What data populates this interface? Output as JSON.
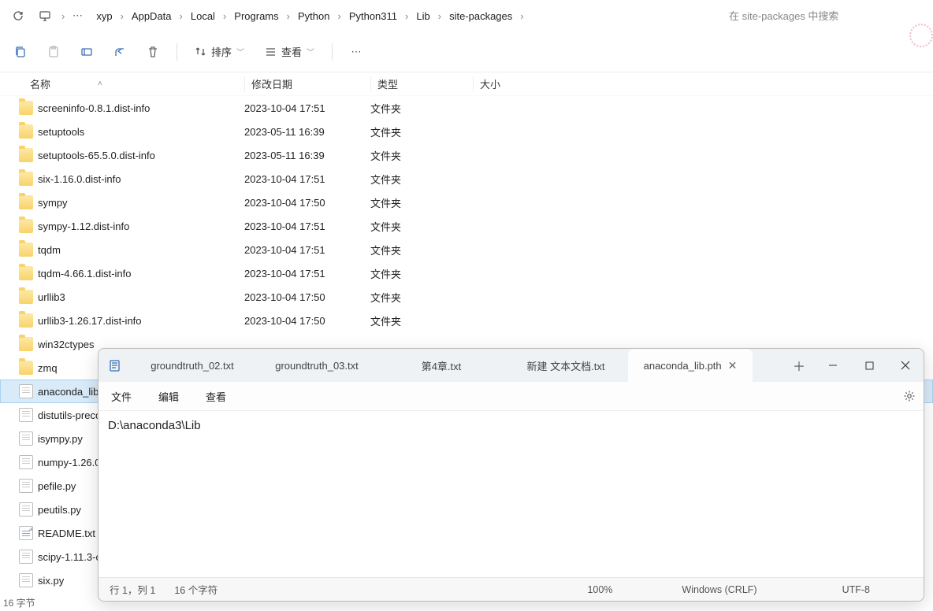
{
  "breadcrumb": {
    "items": [
      "xyp",
      "AppData",
      "Local",
      "Programs",
      "Python",
      "Python311",
      "Lib",
      "site-packages"
    ],
    "search_placeholder": "在 site-packages 中搜索"
  },
  "toolbar": {
    "sort_label": "排序",
    "view_label": "查看"
  },
  "columns": {
    "name": "名称",
    "date": "修改日期",
    "type": "类型",
    "size": "大小"
  },
  "folder_type": "文件夹",
  "files": [
    {
      "icon": "folder",
      "name": "screeninfo-0.8.1.dist-info",
      "date": "2023-10-04 17:51",
      "type": "文件夹"
    },
    {
      "icon": "folder",
      "name": "setuptools",
      "date": "2023-05-11 16:39",
      "type": "文件夹"
    },
    {
      "icon": "folder",
      "name": "setuptools-65.5.0.dist-info",
      "date": "2023-05-11 16:39",
      "type": "文件夹"
    },
    {
      "icon": "folder",
      "name": "six-1.16.0.dist-info",
      "date": "2023-10-04 17:51",
      "type": "文件夹"
    },
    {
      "icon": "folder",
      "name": "sympy",
      "date": "2023-10-04 17:50",
      "type": "文件夹"
    },
    {
      "icon": "folder",
      "name": "sympy-1.12.dist-info",
      "date": "2023-10-04 17:51",
      "type": "文件夹"
    },
    {
      "icon": "folder",
      "name": "tqdm",
      "date": "2023-10-04 17:51",
      "type": "文件夹"
    },
    {
      "icon": "folder",
      "name": "tqdm-4.66.1.dist-info",
      "date": "2023-10-04 17:51",
      "type": "文件夹"
    },
    {
      "icon": "folder",
      "name": "urllib3",
      "date": "2023-10-04 17:50",
      "type": "文件夹"
    },
    {
      "icon": "folder",
      "name": "urllib3-1.26.17.dist-info",
      "date": "2023-10-04 17:50",
      "type": "文件夹"
    },
    {
      "icon": "folder",
      "name": "win32ctypes",
      "date": "",
      "type": ""
    },
    {
      "icon": "folder",
      "name": "zmq",
      "date": "",
      "type": ""
    },
    {
      "icon": "file",
      "name": "anaconda_lib.",
      "date": "",
      "type": "",
      "selected": true
    },
    {
      "icon": "file",
      "name": "distutils-preco",
      "date": "",
      "type": ""
    },
    {
      "icon": "file",
      "name": "isympy.py",
      "date": "",
      "type": ""
    },
    {
      "icon": "file",
      "name": "numpy-1.26.0",
      "date": "",
      "type": ""
    },
    {
      "icon": "file",
      "name": "pefile.py",
      "date": "",
      "type": ""
    },
    {
      "icon": "file",
      "name": "peutils.py",
      "date": "",
      "type": ""
    },
    {
      "icon": "txt",
      "name": "README.txt",
      "date": "",
      "type": ""
    },
    {
      "icon": "file",
      "name": "scipy-1.11.3-c",
      "date": "",
      "type": ""
    },
    {
      "icon": "file",
      "name": "six.py",
      "date": "",
      "type": ""
    }
  ],
  "explorer_status": "16 字节",
  "notepad": {
    "tabs": [
      {
        "label": "groundtruth_02.txt",
        "active": false
      },
      {
        "label": "groundtruth_03.txt",
        "active": false
      },
      {
        "label": "第4章.txt",
        "active": false
      },
      {
        "label": "新建 文本文档.txt",
        "active": false
      },
      {
        "label": "anaconda_lib.pth",
        "active": true
      }
    ],
    "menu": {
      "file": "文件",
      "edit": "编辑",
      "view": "查看"
    },
    "content": "D:\\anaconda3\\Lib",
    "status": {
      "pos": "行 1，列 1",
      "chars": "16 个字符",
      "zoom": "100%",
      "eol": "Windows (CRLF)",
      "enc": "UTF-8"
    }
  }
}
